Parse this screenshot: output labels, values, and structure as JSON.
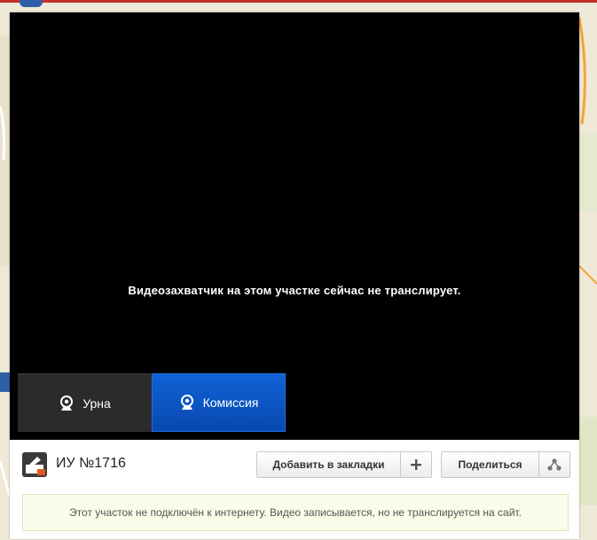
{
  "video": {
    "message": "Видеозахватчик на этом участке сейчас не транслирует."
  },
  "cameras": [
    {
      "label": "Урна",
      "active": false
    },
    {
      "label": "Комиссия",
      "active": true
    }
  ],
  "station": {
    "title": "ИУ №1716"
  },
  "actions": {
    "bookmark_label": "Добавить в закладки",
    "share_label": "Поделиться"
  },
  "notice": {
    "text": "Этот участок не подключён к интернету. Видео записывается, но не транслируется на сайт."
  },
  "colors": {
    "active_tab": "#0a55c4",
    "inactive_tab": "#2b2b2b",
    "video_bg": "#000000",
    "notice_bg": "#fbfbe9"
  }
}
